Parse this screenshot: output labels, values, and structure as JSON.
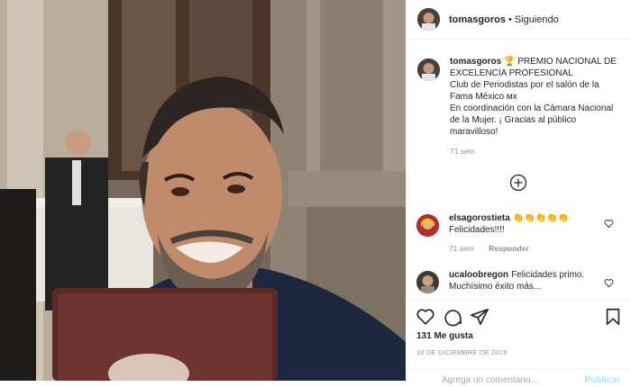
{
  "post": {
    "username": "tomasgoros",
    "separator": "•",
    "follow_status": "Siguiendo",
    "caption": {
      "award_icon": "trophy-emoji",
      "text": "PREMIO NACIONAL DE EXCELENCIA PROFESIONAL \nClub de Periodistas por el salón de la Fama México ᴍx\nEn coordinación con la Cámara Nacional de la Mujer. ¡ Gracias al público maravilloso!",
      "time": "71 sem"
    },
    "comments": [
      {
        "username": "elsagorostieta",
        "text": "👏👏👏👏👏",
        "line2": "Felicidades!!!!",
        "time": "71 sem",
        "reply_label": "Responder"
      },
      {
        "username": "ucaloobregon",
        "text": "Felicidades primo. Muchísimo éxito más..."
      }
    ],
    "likes": "131 Me gusta",
    "date": "10 DE DICIEMBRE DE 2019",
    "add_comment_placeholder": "Agrega un comentario...",
    "publish_label": "Publicar"
  },
  "colors": {
    "accent_blue_disabled": "#b2dffc",
    "secondary_text": "#8e8e8e",
    "border": "#efefef"
  }
}
